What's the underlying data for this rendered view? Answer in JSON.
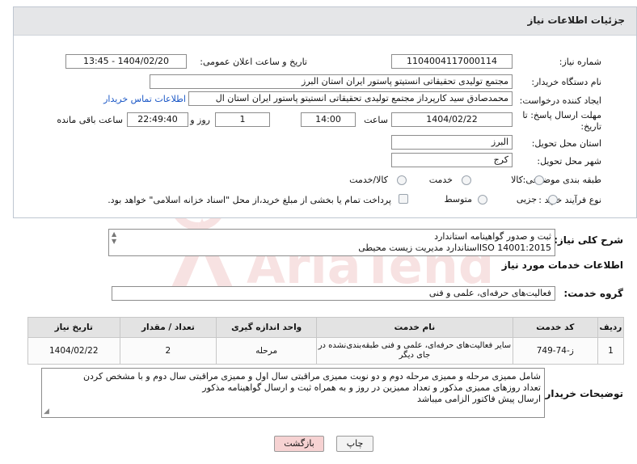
{
  "panel": {
    "title": "جزئیات اطلاعات نیاز"
  },
  "fields": {
    "need_number_label": "شماره نیاز:",
    "need_number": "1104004117000114",
    "announce_label": "تاریخ و ساعت اعلان عمومی:",
    "announce_value": "1404/02/20 - 13:45",
    "buyer_org_label": "نام دستگاه خریدار:",
    "buyer_org": "مجتمع تولیدی تحقیقاتی انستیتو پاستور ایران استان البرز",
    "creator_label": "ایجاد کننده درخواست:",
    "creator": "محمدصادق سید کارپرداز مجتمع تولیدی تحقیقاتی انستیتو پاستور ایران استان ال",
    "contact_link": "اطلاعات تماس خریدار",
    "deadline_label_1": "مهلت ارسال پاسخ: تا",
    "deadline_label_2": "تاریخ:",
    "deadline_date": "1404/02/22",
    "time_label": "ساعت",
    "deadline_time": "14:00",
    "days_value": "1",
    "days_label": "روز و",
    "remaining_time": "22:49:40",
    "remaining_label": "ساعت باقی مانده",
    "province_label": "استان محل تحویل:",
    "province": "البرز",
    "city_label": "شهر محل تحویل:",
    "city": "کرج",
    "category_label": "طبقه بندی موضوعی:",
    "category_options": [
      "کالا",
      "خدمت",
      "کالا/خدمت"
    ],
    "process_label": "نوع فرآیند خرید :",
    "process_options": [
      "جزیی",
      "متوسط"
    ],
    "payment_note": "پرداخت تمام یا بخشی از مبلغ خرید،از محل \"اسناد خزانه اسلامی\" خواهد بود."
  },
  "summary": {
    "label": "شرح کلی نیاز:",
    "line1": "ثبت و صدور گواهینامه استاندارد",
    "line2": "ISO 14001:2015استاندارد مدیریت زیست محیطی"
  },
  "services": {
    "section_title": "اطلاعات خدمات مورد نیاز",
    "group_label": "گروه خدمت:",
    "group_value": "فعالیت‌های حرفه‌ای، علمی و فنی",
    "columns": [
      "ردیف",
      "کد خدمت",
      "نام خدمت",
      "واحد اندازه گیری",
      "تعداد / مقدار",
      "تاریخ نیاز"
    ],
    "rows": [
      {
        "row": "1",
        "code": "ز-74-749",
        "name": "سایر فعالیت‌های حرفه‌ای، علمی و فنی طبقه‌بندی‌نشده در جای دیگر",
        "unit": "مرحله",
        "qty": "2",
        "date": "1404/02/22"
      }
    ]
  },
  "buyer_notes": {
    "label": "توضیحات خریدار:",
    "line1": "شامل  ممیزی مرحله و ممیزی مرحله  دوم و دو نوبت ممیزی مراقبتی سال اول و ممیزی مراقبتی سال دوم و با مشخص کردن",
    "line2": "تعداد روزهای ممیزی مذکور و تعداد ممیزین در روز و به همراه ثبت و ارسال گواهینامه مذکور",
    "line3": "ارسال پیش فاکتور الزامی میباشد"
  },
  "buttons": {
    "print": "چاپ",
    "back": "بازگشت"
  },
  "watermark": {
    "text": "AriaTender.net"
  },
  "colors": {
    "link": "#1a57c6",
    "back_button_bg": "#f6d2d2",
    "watermark": "#c62828"
  }
}
